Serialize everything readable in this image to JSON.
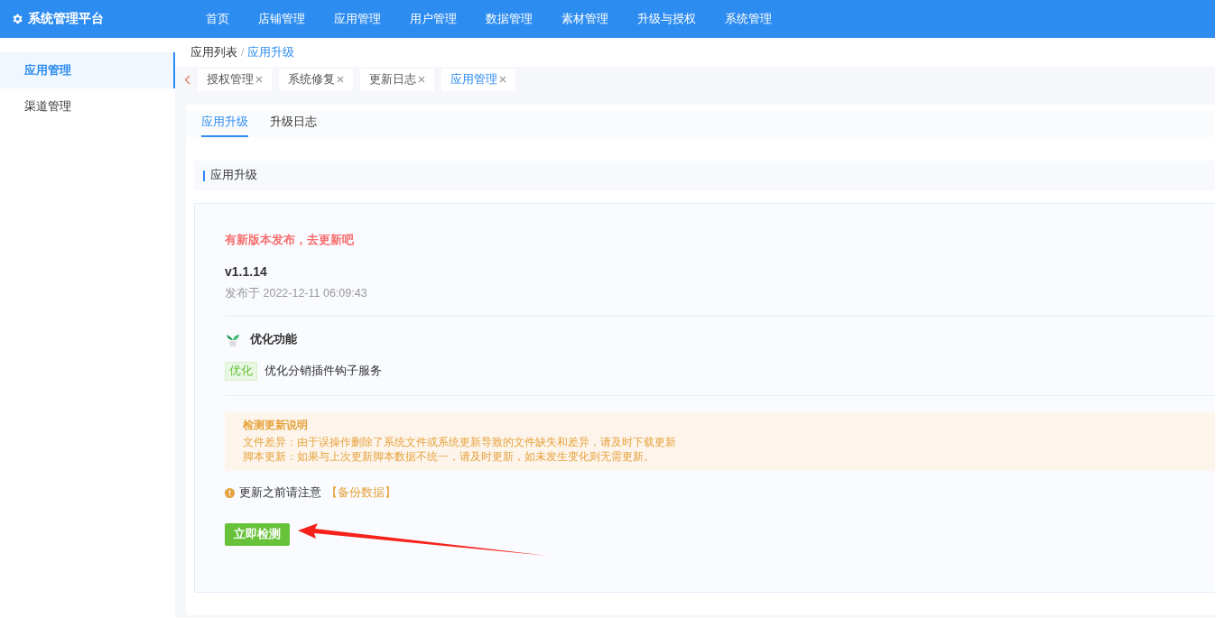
{
  "header": {
    "logo": "系统管理平台",
    "nav": [
      {
        "label": "首页"
      },
      {
        "label": "店铺管理"
      },
      {
        "label": "应用管理"
      },
      {
        "label": "用户管理"
      },
      {
        "label": "数据管理"
      },
      {
        "label": "素材管理"
      },
      {
        "label": "升级与授权"
      },
      {
        "label": "系统管理"
      }
    ]
  },
  "sidebar": {
    "items": [
      {
        "label": "应用管理",
        "selected": true
      },
      {
        "label": "渠道管理",
        "selected": false
      }
    ]
  },
  "breadcrumb_separator": "/",
  "breadcrumb": [
    {
      "label": "应用列表",
      "current": false
    },
    {
      "label": "应用升级",
      "current": true
    }
  ],
  "tags": [
    {
      "label": "授权管理",
      "selected": false
    },
    {
      "label": "系统修复",
      "selected": false
    },
    {
      "label": "更新日志",
      "selected": false
    },
    {
      "label": "应用管理",
      "selected": true
    }
  ],
  "tabs": [
    {
      "label": "应用升级",
      "selected": true
    },
    {
      "label": "升级日志",
      "selected": false
    }
  ],
  "section_title": "应用升级",
  "update": {
    "notice": "有新版本发布，去更新吧",
    "version": "v1.1.14",
    "released": "发布于 2022-12-11 06:09:43",
    "feature_title": "优化功能",
    "changes": [
      {
        "tag": "优化",
        "text": "优化分销插件钩子服务"
      }
    ]
  },
  "info": {
    "title": "检测更新说明",
    "lines": [
      "文件差异：由于误操作删除了系统文件或系统更新导致的文件缺失和差异，请及时下载更新",
      "脚本更新：如果与上次更新脚本数据不统一，请及时更新，如未发生变化则无需更新。"
    ]
  },
  "warning": {
    "text": "更新之前请注意",
    "link": "【备份数据】"
  },
  "button": "立即检测"
}
